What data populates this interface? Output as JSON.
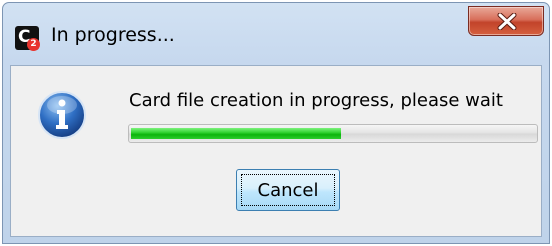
{
  "window": {
    "title": "In progress...",
    "app_icon": "c2-app-icon",
    "close_icon": "close-icon"
  },
  "dialog": {
    "icon": "info-icon",
    "message": "Card file creation in progress, please wait",
    "progress_fraction": 0.52,
    "progress_color": "#0cb40c",
    "cancel_label": "Cancel"
  },
  "colors": {
    "close_button": "#c2432a",
    "info_icon": "#2a5fa8"
  }
}
